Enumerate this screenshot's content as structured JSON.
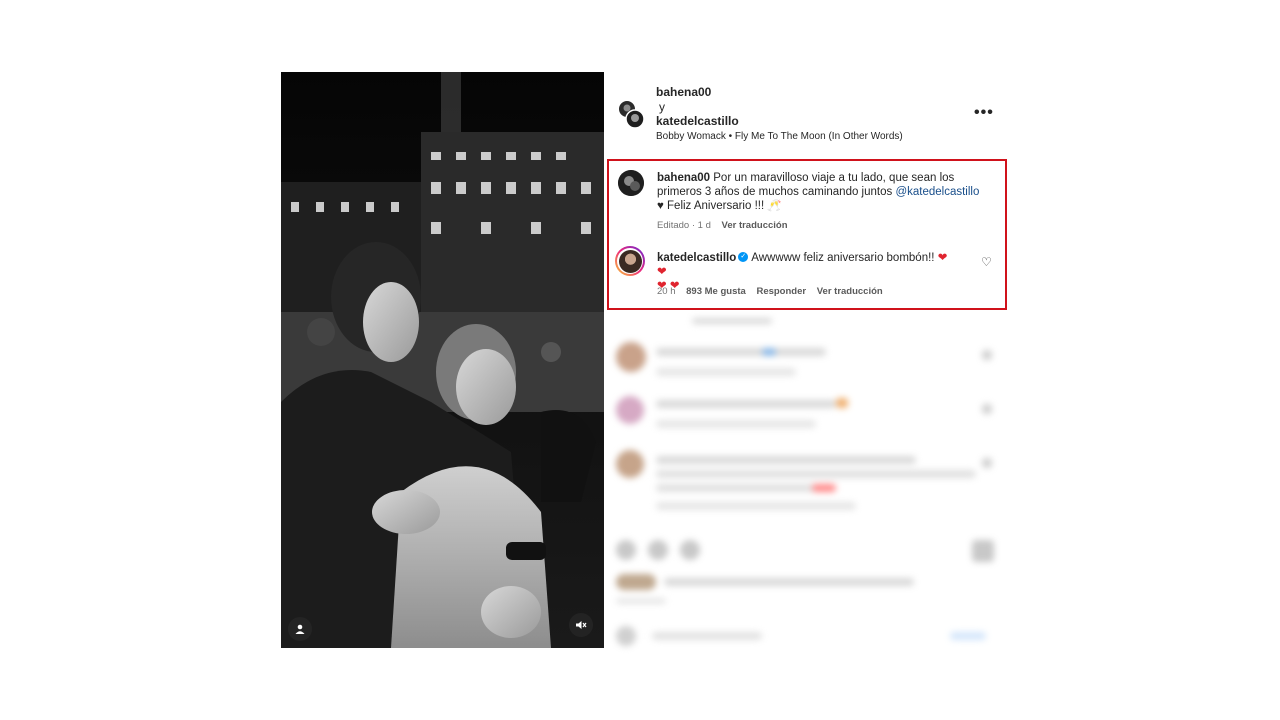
{
  "post": {
    "author1": "bahena00",
    "joiner": "y",
    "author2": "katedelcastillo",
    "song": "Bobby Womack • Fly Me To The Moon (In Other Words)",
    "more_icon": "more-horizontal-icon"
  },
  "caption": {
    "username": "bahena00",
    "text": "Por un maravilloso viaje a tu lado, que sean los primeros 3 años de muchos caminando juntos",
    "mention": "@katedelcastillo",
    "line3": "♥ Feliz Aniversario !!! 🥂",
    "edited": "Editado · 1 d",
    "translate": "Ver traducción"
  },
  "reply": {
    "username": "katedelcastillo",
    "text": "Awwwww feliz aniversario bombón!!",
    "hearts_inline": "❤ ❤",
    "hearts_line2": "❤ ❤",
    "time": "20 h",
    "likes": "893 Me gusta",
    "reply_label": "Responder",
    "translate": "Ver traducción"
  },
  "colors": {
    "highlight_border": "#d0121b",
    "mention": "#1a4f8b",
    "verified": "#0095f6",
    "heart": "#e0242f"
  },
  "media_icons": [
    "user-tag-icon",
    "mute-icon"
  ]
}
